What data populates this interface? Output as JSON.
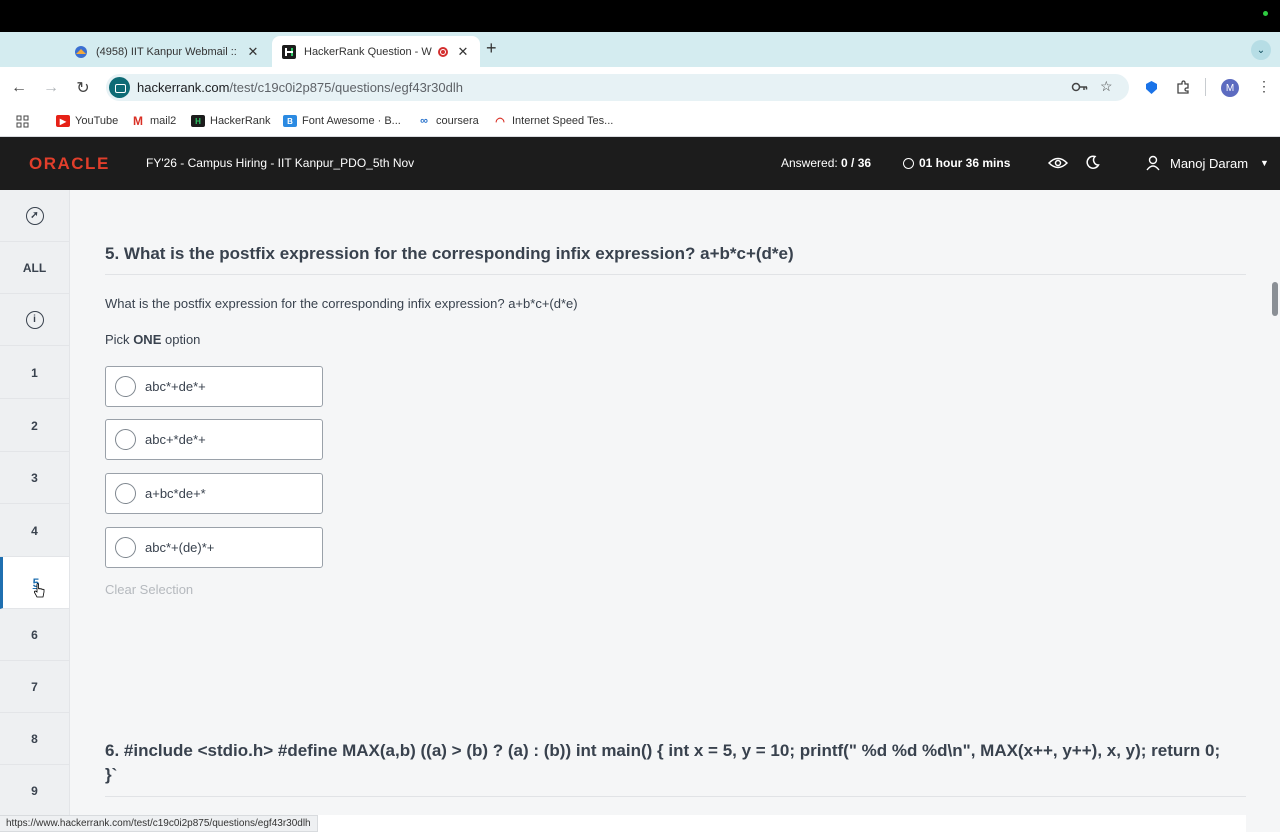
{
  "browser": {
    "tabs": [
      {
        "title": "(4958) IIT Kanpur Webmail ::",
        "active": false
      },
      {
        "title": "HackerRank Question - W",
        "active": true
      }
    ],
    "new_tab": "+",
    "tab_menu": "⌄",
    "url_host": "hackerrank.com",
    "url_path": "/test/c19c0i2p875/questions/egf43r30dlh",
    "profile_initial": "M",
    "bookmarks": [
      {
        "label": "YouTube",
        "icon": "youtube-icon",
        "color": "#e62117"
      },
      {
        "label": "mail2",
        "icon": "gmail-icon",
        "color": "#d93025"
      },
      {
        "label": "HackerRank",
        "icon": "hackerrank-icon",
        "color": "#1c1c1c"
      },
      {
        "label": "Font Awesome · B...",
        "icon": "bootstrap-icon",
        "color": "#2b8ae2"
      },
      {
        "label": "coursera",
        "icon": "coursera-icon",
        "color": "#2a73cc"
      },
      {
        "label": "Internet Speed Tes...",
        "icon": "speedtest-icon",
        "color": "#d93025"
      }
    ],
    "status_url": "https://www.hackerrank.com/test/c19c0i2p875/questions/egf43r30dlh"
  },
  "header": {
    "logo": "ORACLE",
    "test_name": "FY'26 - Campus Hiring - IIT Kanpur_PDO_5th Nov",
    "answered_label": "Answered:",
    "answered_value": "0 / 36",
    "timer": "01 hour 36 mins",
    "user_name": "Manoj Daram"
  },
  "sidebar": {
    "all_label": "ALL",
    "questions": [
      "1",
      "2",
      "3",
      "4",
      "5",
      "6",
      "7",
      "8",
      "9"
    ],
    "active_question": "5"
  },
  "question5": {
    "title": "5. What is the postfix expression for the corresponding infix expression? a+b*c+(d*e)",
    "body": "What is the postfix expression for the corresponding infix expression? a+b*c+(d*e)",
    "pick_prefix": "Pick",
    "pick_emphasis": "ONE",
    "pick_suffix": "option",
    "options": [
      "abc*+de*+",
      "abc+*de*+",
      "a+bc*de+*",
      "abc*+(de)*+"
    ],
    "clear_label": "Clear Selection"
  },
  "question6": {
    "title": "6. #include <stdio.h> #define MAX(a,b) ((a) > (b) ? (a) : (b)) int main() { int x = 5, y = 10; printf(\" %d %d %d\\n\", MAX(x++, y++), x, y); return 0; }`"
  },
  "colors": {
    "header_bg": "#1c1c1c",
    "oracle_red": "#e13e2b",
    "active_blue": "#1f6fb0",
    "tabstrip": "#d4ecf0"
  }
}
